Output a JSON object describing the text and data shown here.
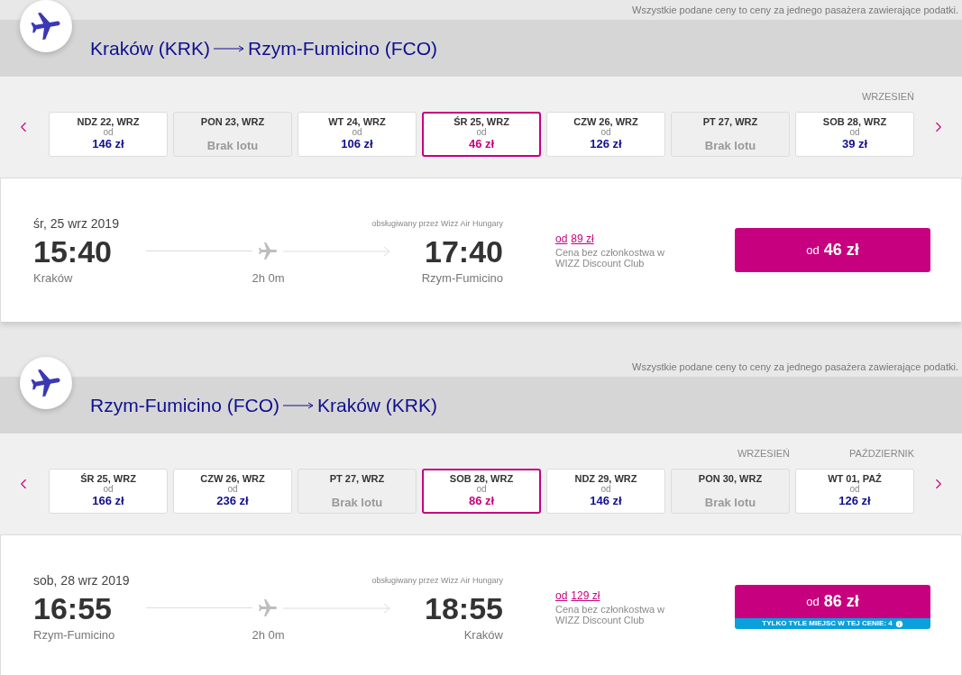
{
  "legs": [
    {
      "disclaimer": "Wszystkie podane ceny to ceny za jednego pasażera zawierające podatki.",
      "route": {
        "origin": "Kraków (KRK)",
        "destination": "Rzym-Fumicino (FCO)"
      },
      "dates": [
        {
          "kind": "fare",
          "label": "NDZ 22, WRZ",
          "from_label": "od",
          "price": "146 zł",
          "selected": false
        },
        {
          "kind": "no-flight",
          "label": "PON 23, WRZ",
          "note": "Brak lotu",
          "selected": false
        },
        {
          "kind": "fare",
          "label": "WT 24, WRZ",
          "from_label": "od",
          "price": "106 zł",
          "selected": false
        },
        {
          "kind": "fare",
          "label": "ŚR 25, WRZ",
          "from_label": "od",
          "price": "46 zł",
          "selected": true
        },
        {
          "kind": "fare",
          "label": "CZW 26, WRZ",
          "from_label": "od",
          "price": "126 zł",
          "selected": false
        },
        {
          "kind": "no-flight",
          "label": "PT 27, WRZ",
          "note": "Brak lotu",
          "selected": false
        },
        {
          "kind": "fare",
          "label": "SOB 28, WRZ",
          "from_label": "od",
          "price": "39 zł",
          "selected": false,
          "month": "WRZESIEŃ"
        }
      ],
      "flight": {
        "date": "śr, 25 wrz 2019",
        "operator": "obsługiwany przez Wizz Air Hungary",
        "departure_time": "15:40",
        "departure_city": "Kraków",
        "duration": "2h 0m",
        "arrival_time": "17:40",
        "arrival_city": "Rzym-Fumicino",
        "member_price": {
          "prefix": "od",
          "price": "89 zł",
          "note": "Cena bez członkostwa w WIZZ Discount Club"
        },
        "fare_button": {
          "prefix": "od",
          "price": "46 zł"
        }
      }
    },
    {
      "disclaimer": "Wszystkie podane ceny to ceny za jednego pasażera zawierające podatki.",
      "route": {
        "origin": "Rzym-Fumicino (FCO)",
        "destination": "Kraków (KRK)"
      },
      "dates": [
        {
          "kind": "fare",
          "label": "ŚR 25, WRZ",
          "from_label": "od",
          "price": "166 zł",
          "selected": false
        },
        {
          "kind": "fare",
          "label": "CZW 26, WRZ",
          "from_label": "od",
          "price": "236 zł",
          "selected": false
        },
        {
          "kind": "no-flight",
          "label": "PT 27, WRZ",
          "note": "Brak lotu",
          "selected": false
        },
        {
          "kind": "fare",
          "label": "SOB 28, WRZ",
          "from_label": "od",
          "price": "86 zł",
          "selected": true
        },
        {
          "kind": "fare",
          "label": "NDZ 29, WRZ",
          "from_label": "od",
          "price": "146 zł",
          "selected": false
        },
        {
          "kind": "no-flight",
          "label": "PON 30, WRZ",
          "note": "Brak lotu",
          "selected": false,
          "month": "WRZESIEŃ"
        },
        {
          "kind": "fare",
          "label": "WT 01, PAŹ",
          "from_label": "od",
          "price": "126 zł",
          "selected": false,
          "month": "PAŹDZIERNIK"
        }
      ],
      "flight": {
        "date": "sob, 28 wrz 2019",
        "operator": "obsługiwany przez Wizz Air Hungary",
        "departure_time": "16:55",
        "departure_city": "Rzym-Fumicino",
        "duration": "2h 0m",
        "arrival_time": "18:55",
        "arrival_city": "Kraków",
        "member_price": {
          "prefix": "od",
          "price": "129 zł",
          "note": "Cena bez członkostwa w WIZZ Discount Club"
        },
        "fare_button": {
          "prefix": "od",
          "price": "86 zł"
        },
        "seats_notice": "TYLKO TYLE MIEJSC W TEJ CENIE: 4"
      }
    }
  ]
}
